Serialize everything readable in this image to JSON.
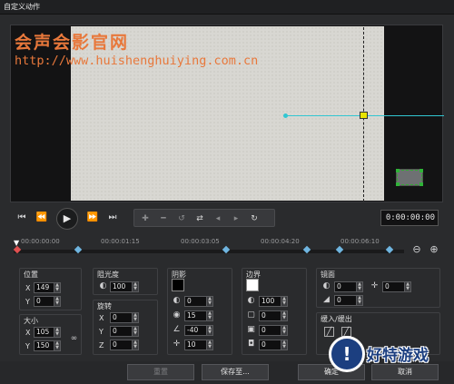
{
  "window": {
    "title": "自定义动作"
  },
  "watermark": {
    "line1": "会声会影官网",
    "line2": "http://www.huishenghuiying.com.cn"
  },
  "transport": {
    "timecode": "0:00:00:00"
  },
  "timeline": {
    "ticks": [
      "00:00:00:00",
      "00:00:01:15",
      "00:00:03:05",
      "00:00:04:20",
      "00:00:06:10"
    ]
  },
  "position": {
    "label": "位置",
    "x_label": "X",
    "y_label": "Y",
    "x": "149",
    "y": "0"
  },
  "size": {
    "label": "大小",
    "x_label": "X",
    "y_label": "Y",
    "x": "105",
    "y": "150"
  },
  "opacity": {
    "label": "阻光度",
    "value": "100"
  },
  "rotation": {
    "label": "旋转",
    "x_label": "X",
    "y_label": "Y",
    "z_label": "Z",
    "x": "0",
    "y": "0",
    "z": "0"
  },
  "shadow": {
    "label": "阴影",
    "color": "#000000",
    "opacity": "0",
    "blur": "15",
    "direction": "-40",
    "distance": "10"
  },
  "border": {
    "label": "边界",
    "color": "#ffffff",
    "opacity": "100",
    "v1": "0",
    "v2": "0",
    "v3": "0",
    "v4": "0"
  },
  "mirror": {
    "label": "镜面",
    "v1": "0",
    "v2": "0",
    "v3": "0",
    "v4": "0"
  },
  "fade": {
    "label": "缓入/缓出"
  },
  "buttons": {
    "reset": "重置",
    "save_to": "保存至...",
    "ok": "确定",
    "cancel": "取消"
  },
  "logo": {
    "text": "好特游戏"
  }
}
